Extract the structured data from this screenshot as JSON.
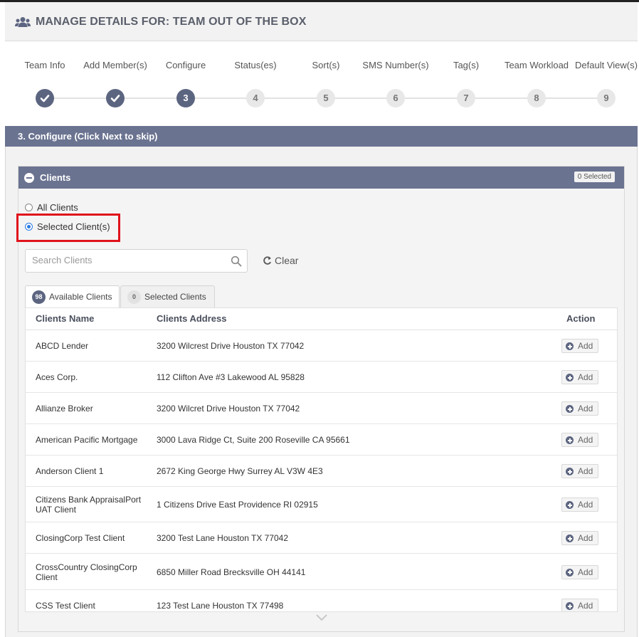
{
  "header": {
    "title": "MANAGE DETAILS FOR: TEAM OUT OF THE BOX",
    "icon": "users-icon"
  },
  "wizard": {
    "steps": [
      {
        "label": "Team Info",
        "mark": "",
        "state": "done"
      },
      {
        "label": "Add Member(s)",
        "mark": "",
        "state": "done"
      },
      {
        "label": "Configure",
        "mark": "3",
        "state": "current"
      },
      {
        "label": "Status(es)",
        "mark": "4",
        "state": "todo"
      },
      {
        "label": "Sort(s)",
        "mark": "5",
        "state": "todo"
      },
      {
        "label": "SMS Number(s)",
        "mark": "6",
        "state": "todo"
      },
      {
        "label": "Tag(s)",
        "mark": "7",
        "state": "todo"
      },
      {
        "label": "Team Workload",
        "mark": "8",
        "state": "todo"
      },
      {
        "label": "Default View(s)",
        "mark": "9",
        "state": "todo"
      }
    ]
  },
  "section": {
    "title": "3. Configure (Click Next to skip)"
  },
  "clients_panel": {
    "title": "Clients",
    "selected_badge": "0 Selected",
    "radio_all": "All Clients",
    "radio_selected": "Selected Client(s)",
    "radio_checked": "selected",
    "search_placeholder": "Search Clients",
    "search_value": "",
    "clear_label": "Clear",
    "tabs": [
      {
        "count": "98",
        "label": "Available Clients",
        "active": true
      },
      {
        "count": "0",
        "label": "Selected Clients",
        "active": false
      }
    ],
    "columns": {
      "name": "Clients Name",
      "address": "Clients Address",
      "action": "Action"
    },
    "add_label": "Add",
    "rows": [
      {
        "name": "ABCD Lender",
        "address": "3200 Wilcrest Drive Houston TX 77042"
      },
      {
        "name": "Aces Corp.",
        "address": "112 Clifton Ave #3 Lakewood AL 95828"
      },
      {
        "name": "Allianze Broker",
        "address": "3200 Wilcret Drive Houston TX 77042"
      },
      {
        "name": "American Pacific Mortgage",
        "address": "3000 Lava Ridge Ct, Suite 200 Roseville CA 95661"
      },
      {
        "name": "Anderson Client 1",
        "address": "2672 King George Hwy Surrey AL V3W 4E3"
      },
      {
        "name": "Citizens Bank AppraisalPort UAT Client",
        "address": "1 Citizens Drive East Providence RI 02915"
      },
      {
        "name": "ClosingCorp Test Client",
        "address": "3200 Test Lane Houston TX 77042"
      },
      {
        "name": "CrossCountry ClosingCorp Client",
        "address": "6850 Miller Road Brecksville OH 44141"
      },
      {
        "name": "CSS Test Client",
        "address": "123 Test Lane Houston TX 77498"
      }
    ]
  },
  "colors": {
    "accent": "#6a7390",
    "step_active": "#5c6580",
    "highlight": "#e0121b",
    "radio": "#2a7be4"
  }
}
